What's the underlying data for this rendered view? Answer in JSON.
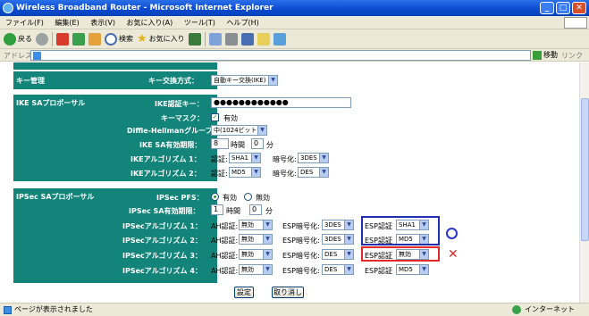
{
  "window": {
    "title": "Wireless Broadband Router - Microsoft Internet Explorer"
  },
  "menu": [
    "ファイル(F)",
    "編集(E)",
    "表示(V)",
    "お気に入り(A)",
    "ツール(T)",
    "ヘルプ(H)"
  ],
  "toolbar": {
    "back": "戻る",
    "search": "検索",
    "favorites": "お気に入り"
  },
  "address": {
    "label": "アドレス(D)",
    "go": "移動",
    "links": "リンク"
  },
  "key_mgmt": {
    "section": "キー管理",
    "label": "キー交換方式：",
    "value": "自動キー交換(IKE)"
  },
  "ike": {
    "section": "IKE SAプロポーサル",
    "key_label": "IKE認証キー：",
    "key_value": "●●●●●●●●●●●●",
    "mask_label": "キーマスク：",
    "mask_value": "有効",
    "dh_label": "Diffie-Hellmanグループ：",
    "dh_value": "中(1024ビット)",
    "life_label": "IKE SA有効期限：",
    "life_hours": "8",
    "hours_unit": "時間",
    "life_min": "0",
    "min_unit": "分",
    "alg1_label": "IKEアルゴリズム 1：",
    "alg2_label": "IKEアルゴリズム 2：",
    "auth_label": "認証:",
    "enc_label": "暗号化:",
    "alg1_auth": "SHA1",
    "alg1_enc": "3DES",
    "alg2_auth": "MD5",
    "alg2_enc": "DES"
  },
  "ipsec": {
    "section": "IPSec SAプロポーサル",
    "pfs_label": "IPSec PFS：",
    "pfs_on": "有効",
    "pfs_off": "無効",
    "life_label": "IPSec SA有効期限：",
    "life_hours": "1",
    "hours_unit": "時間",
    "life_min": "0",
    "min_unit": "分",
    "ah_label": "AH認証:",
    "esp_enc_label": "ESP暗号化:",
    "esp_auth_label": "ESP認証",
    "rows": [
      {
        "label": "IPSecアルゴリズム 1：",
        "ah": "無効",
        "enc": "3DES",
        "auth": "SHA1"
      },
      {
        "label": "IPSecアルゴリズム 2：",
        "ah": "無効",
        "enc": "3DES",
        "auth": "MD5"
      },
      {
        "label": "IPSecアルゴリズム 3：",
        "ah": "無効",
        "enc": "DES",
        "auth": "無効"
      },
      {
        "label": "IPSecアルゴリズム 4：",
        "ah": "無効",
        "enc": "DES",
        "auth": "MD5"
      }
    ]
  },
  "buttons": {
    "apply": "設定",
    "cancel": "取り消し"
  },
  "status": {
    "text": "ページが表示されました",
    "zone": "インターネット"
  },
  "annotations": {
    "ok": "○",
    "ng": "×"
  }
}
